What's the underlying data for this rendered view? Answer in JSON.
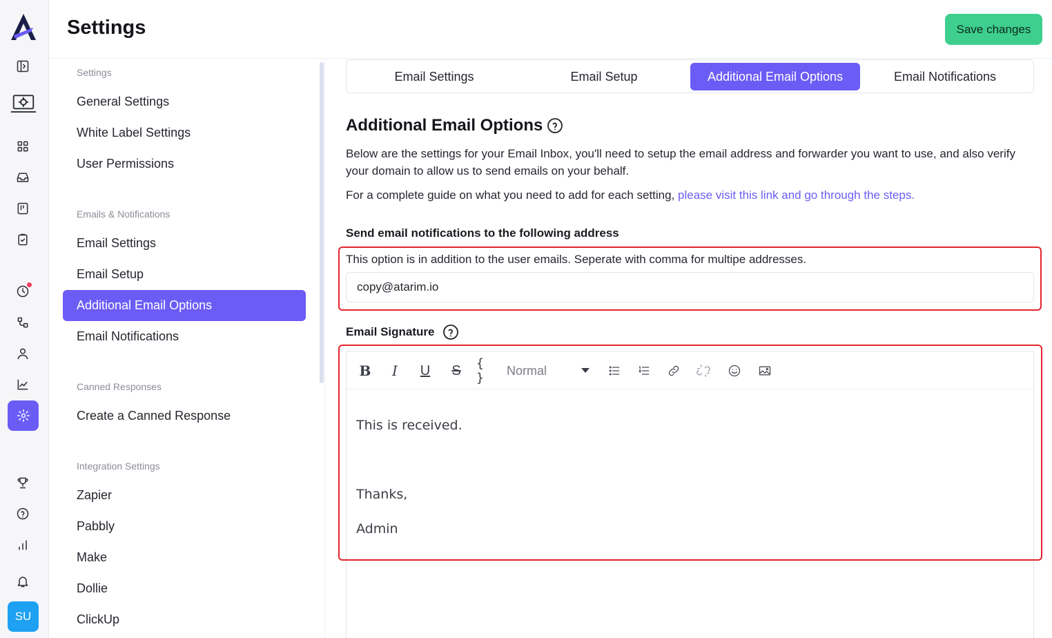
{
  "header": {
    "title": "Settings",
    "save_label": "Save changes"
  },
  "rail": {
    "icons": [
      "logo",
      "panel-toggle-icon",
      "laptop-gear-icon",
      "grid-icon",
      "inbox-icon",
      "board-icon",
      "clipboard-icon",
      "clock-icon",
      "workflow-icon",
      "user-icon",
      "chart-line-icon",
      "gear-icon",
      "trophy-icon",
      "help-icon",
      "bar-chart-icon",
      "bell-icon"
    ],
    "avatar": "SU"
  },
  "subnav": {
    "sections": [
      {
        "title": "Settings",
        "items": [
          "General Settings",
          "White Label Settings",
          "User Permissions"
        ]
      },
      {
        "title": "Emails & Notifications",
        "items": [
          "Email Settings",
          "Email Setup",
          "Additional Email Options",
          "Email Notifications"
        ]
      },
      {
        "title": "Canned Responses",
        "items": [
          "Create a Canned Response"
        ]
      },
      {
        "title": "Integration Settings",
        "items": [
          "Zapier",
          "Pabbly",
          "Make",
          "Dollie",
          "ClickUp"
        ]
      }
    ],
    "active_item": "Additional Email Options"
  },
  "tabs": [
    "Email Settings",
    "Email Setup",
    "Additional Email Options",
    "Email Notifications"
  ],
  "main": {
    "heading": "Additional Email Options",
    "description": "Below are the settings for your Email Inbox, you'll need to setup the email address and forwarder you want to use, and also verify your domain to allow us to send emails on your behalf.",
    "guide_prefix": "For a complete guide on what you need to add for each setting, ",
    "guide_link": "please visit this link and go through the steps.",
    "notify_label": "Send email notifications to the following address",
    "notify_hint": "This option is in addition to the user emails. Seperate with comma for multipe addresses.",
    "notify_value": "copy@atarim.io",
    "signature_label": "Email Signature",
    "editor": {
      "format_value": "Normal",
      "lines": [
        "This is received.",
        "Thanks,",
        "Admin"
      ]
    }
  },
  "colors": {
    "accent": "#6b5cf6",
    "save": "#3ecf8e",
    "highlight": "#e4242d"
  }
}
